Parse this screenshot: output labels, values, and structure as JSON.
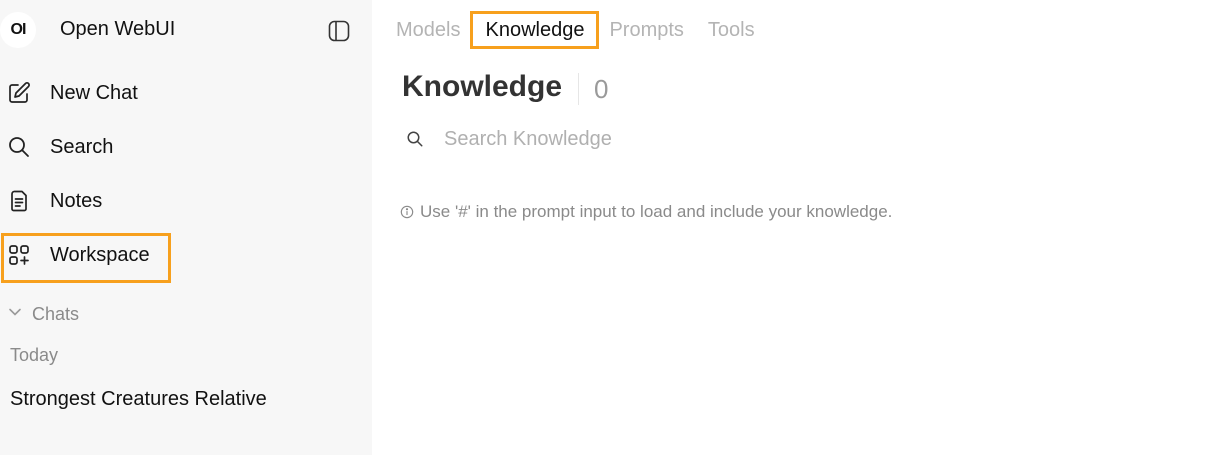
{
  "brand": {
    "logo_text": "OI",
    "name": "Open WebUI"
  },
  "sidebar": {
    "toggle_icon": "sidebar-toggle-icon",
    "items": [
      {
        "label": "New Chat",
        "icon": "pencil-square-icon"
      },
      {
        "label": "Search",
        "icon": "search-icon"
      },
      {
        "label": "Notes",
        "icon": "notes-icon"
      },
      {
        "label": "Workspace",
        "icon": "grid-plus-icon"
      }
    ],
    "chats_label": "Chats",
    "today_label": "Today",
    "chat_items": [
      "Strongest Creatures Relative"
    ]
  },
  "tabs": [
    "Models",
    "Knowledge",
    "Prompts",
    "Tools"
  ],
  "active_tab": "Knowledge",
  "page": {
    "title": "Knowledge",
    "count": "0",
    "search_placeholder": "Search Knowledge",
    "hint": "Use '#' in the prompt input to load and include your knowledge."
  },
  "colors": {
    "highlight": "#f7a01d",
    "sidebar_bg": "#f7f7f7"
  }
}
